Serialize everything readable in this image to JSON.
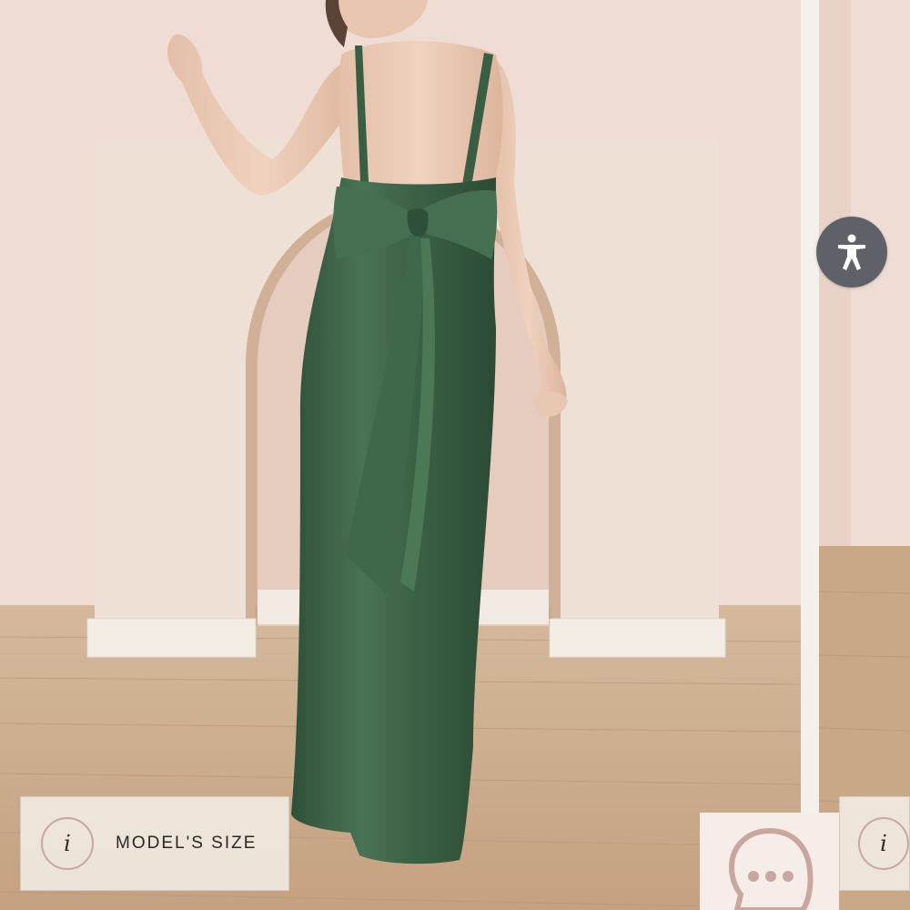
{
  "gallery": {
    "main_image": {
      "alt": "Model wearing green satin backless bow dress"
    },
    "next_image": {
      "alt": "Next gallery image"
    }
  },
  "badges": {
    "model_size": {
      "icon_text": "i",
      "label": "MODEL'S SIZE"
    },
    "next_slide_info": {
      "icon_text": "i"
    }
  },
  "accessibility": {
    "icon": "accessibility-person-icon"
  },
  "chat": {
    "icon": "chat-bubble-icon"
  },
  "colors": {
    "wall": "#efdcd4",
    "fireplace": "#efe0d6",
    "floor": "#c9a98a",
    "dress": "#3e6447",
    "badge_border": "#c9a6a0",
    "a11y_button": "#5f6168",
    "chat_icon": "#c9a6a0"
  }
}
